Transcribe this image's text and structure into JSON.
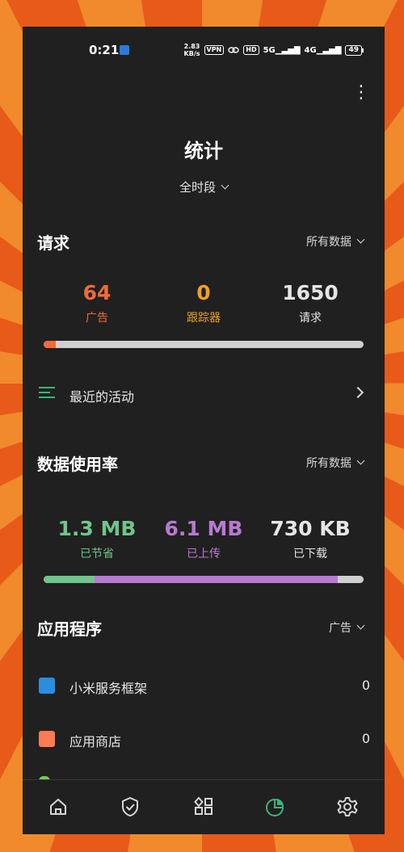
{
  "status_bar": {
    "time": "0:21",
    "net_speed_value": "2.83",
    "net_speed_unit": "KB/s",
    "vpn_label": "VPN",
    "hd_label": "HD",
    "net1": "5G",
    "net2": "4G",
    "battery": "49"
  },
  "header": {
    "title": "统计",
    "period": "全时段"
  },
  "requests": {
    "title": "请求",
    "filter": "所有数据",
    "stats": [
      {
        "value": "64",
        "label": "广告",
        "color": "#f06a3a"
      },
      {
        "value": "0",
        "label": "跟踪器",
        "color": "#f0a020"
      },
      {
        "value": "1650",
        "label": "请求",
        "color": "#e6e6e6"
      }
    ],
    "bar_fraction_ads": 0.039
  },
  "activity": {
    "label": "最近的活动"
  },
  "data_usage": {
    "title": "数据使用率",
    "filter": "所有数据",
    "stats": [
      {
        "value": "1.3 MB",
        "label": "已节省",
        "color": "#6fc58a"
      },
      {
        "value": "6.1 MB",
        "label": "已上传",
        "color": "#b67ad0"
      },
      {
        "value": "730 KB",
        "label": "已下载",
        "color": "#e6e6e6"
      }
    ],
    "bar_fraction_saved": 0.16,
    "bar_fraction_uploaded": 0.76
  },
  "apps": {
    "title": "应用程序",
    "filter": "广告",
    "items": [
      {
        "name": "小米服务框架",
        "count": "0",
        "icon_color": "#2a8ee0"
      },
      {
        "name": "应用商店",
        "count": "0",
        "icon_color": "#ff7a52"
      }
    ]
  },
  "colors": {
    "accent_green": "#3fb27f",
    "ads": "#f06a3a",
    "trackers": "#f0a020",
    "saved": "#6fc58a",
    "uploaded": "#b67ad0",
    "track": "#cfcfcf"
  },
  "nav": {
    "items": [
      "home-icon",
      "shield-check-icon",
      "apps-grid-icon",
      "statistics-icon",
      "settings-icon"
    ],
    "active": "statistics-icon"
  }
}
